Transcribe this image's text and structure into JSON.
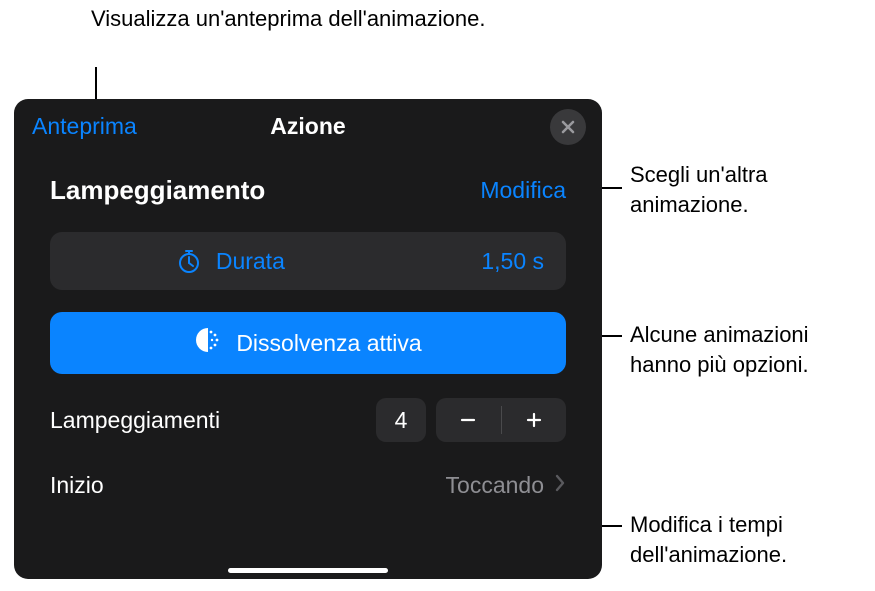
{
  "callouts": {
    "previewCallout": "Visualizza un'anteprima dell'animazione.",
    "modifyCallout": "Scegli un'altra animazione.",
    "optionsCallout": "Alcune animazioni hanno più opzioni.",
    "startCallout": "Modifica i tempi dell'animazione."
  },
  "panel": {
    "previewLink": "Anteprima",
    "title": "Azione",
    "animationName": "Lampeggiamento",
    "modifyLink": "Modifica",
    "duration": {
      "label": "Durata",
      "value": "1,50 s"
    },
    "optionButton": "Dissolvenza attiva",
    "blinks": {
      "label": "Lampeggiamenti",
      "value": "4"
    },
    "start": {
      "label": "Inizio",
      "value": "Toccando"
    }
  }
}
